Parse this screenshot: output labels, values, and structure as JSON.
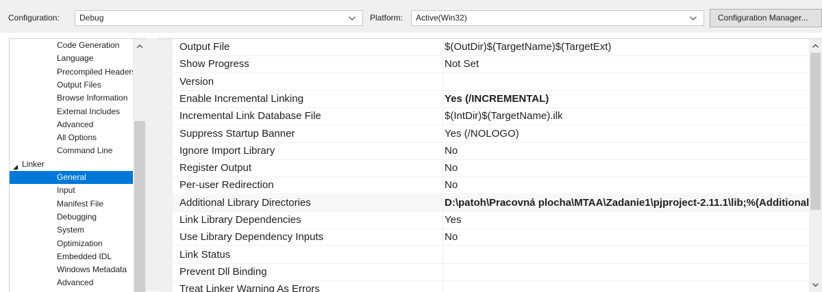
{
  "toolbar": {
    "configuration_label": "Configuration:",
    "configuration_value": "Debug",
    "platform_label": "Platform:",
    "platform_value": "Active(Win32)",
    "config_manager_label": "Configuration Manager..."
  },
  "tree": {
    "items": [
      {
        "label": "Code Generation",
        "indent": 2,
        "selected": false
      },
      {
        "label": "Language",
        "indent": 2,
        "selected": false
      },
      {
        "label": "Precompiled Headers",
        "indent": 2,
        "selected": false
      },
      {
        "label": "Output Files",
        "indent": 2,
        "selected": false
      },
      {
        "label": "Browse Information",
        "indent": 2,
        "selected": false
      },
      {
        "label": "External Includes",
        "indent": 2,
        "selected": false
      },
      {
        "label": "Advanced",
        "indent": 2,
        "selected": false
      },
      {
        "label": "All Options",
        "indent": 2,
        "selected": false
      },
      {
        "label": "Command Line",
        "indent": 2,
        "selected": false
      },
      {
        "label": "Linker",
        "indent": 1,
        "selected": false,
        "expanded": true
      },
      {
        "label": "General",
        "indent": 2,
        "selected": true
      },
      {
        "label": "Input",
        "indent": 2,
        "selected": false
      },
      {
        "label": "Manifest File",
        "indent": 2,
        "selected": false
      },
      {
        "label": "Debugging",
        "indent": 2,
        "selected": false
      },
      {
        "label": "System",
        "indent": 2,
        "selected": false
      },
      {
        "label": "Optimization",
        "indent": 2,
        "selected": false
      },
      {
        "label": "Embedded IDL",
        "indent": 2,
        "selected": false
      },
      {
        "label": "Windows Metadata",
        "indent": 2,
        "selected": false
      },
      {
        "label": "Advanced",
        "indent": 2,
        "selected": false
      }
    ]
  },
  "properties": {
    "rows": [
      {
        "name": "Output File",
        "value": "$(OutDir)$(TargetName)$(TargetExt)",
        "bold": false
      },
      {
        "name": "Show Progress",
        "value": "Not Set",
        "bold": false
      },
      {
        "name": "Version",
        "value": "",
        "bold": false
      },
      {
        "name": "Enable Incremental Linking",
        "value": "Yes (/INCREMENTAL)",
        "bold": true
      },
      {
        "name": "Incremental Link Database File",
        "value": "$(IntDir)$(TargetName).ilk",
        "bold": false
      },
      {
        "name": "Suppress Startup Banner",
        "value": "Yes (/NOLOGO)",
        "bold": false
      },
      {
        "name": "Ignore Import Library",
        "value": "No",
        "bold": false
      },
      {
        "name": "Register Output",
        "value": "No",
        "bold": false
      },
      {
        "name": "Per-user Redirection",
        "value": "No",
        "bold": false
      },
      {
        "name": "Additional Library Directories",
        "value": "D:\\patoh\\Pracovná plocha\\MTAA\\Zadanie1\\pjproject-2.11.1\\lib;%(AdditionalLibraryDirectories)",
        "bold": true
      },
      {
        "name": "Link Library Dependencies",
        "value": "Yes",
        "bold": false
      },
      {
        "name": "Use Library Dependency Inputs",
        "value": "No",
        "bold": false
      },
      {
        "name": "Link Status",
        "value": "",
        "bold": false
      },
      {
        "name": "Prevent Dll Binding",
        "value": "",
        "bold": false
      },
      {
        "name": "Treat Linker Warning As Errors",
        "value": "",
        "bold": false
      }
    ]
  },
  "colors": {
    "selection": "#0078d7",
    "chrome": "#f0f0f0"
  }
}
